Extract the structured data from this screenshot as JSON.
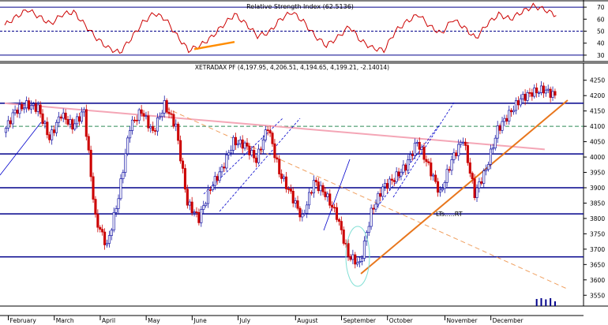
{
  "chart_data": [
    {
      "type": "line",
      "title": "Relative Strength Index (62.5136)",
      "y_ticks": [
        30,
        40,
        50,
        60,
        70
      ],
      "ylim": [
        26,
        74
      ],
      "reference_lines": [
        70,
        50,
        30
      ],
      "x_weeks": [
        0,
        1,
        2,
        3,
        4,
        5,
        6,
        7,
        8,
        9,
        10,
        11,
        12,
        13,
        14,
        15,
        16,
        17,
        18,
        19,
        20,
        21,
        22,
        23,
        24,
        25,
        26,
        27,
        28,
        29,
        30,
        31,
        32,
        33,
        34,
        35,
        36,
        37,
        38,
        39,
        40,
        41,
        42,
        43,
        44,
        45,
        46,
        47,
        48
      ],
      "values": [
        55,
        62,
        68,
        62,
        56,
        64,
        66,
        55,
        44,
        36,
        32,
        44,
        57,
        65,
        60,
        46,
        34,
        38,
        45,
        55,
        64,
        56,
        46,
        49,
        60,
        66,
        58,
        46,
        38,
        45,
        54,
        42,
        36,
        34,
        50,
        58,
        64,
        54,
        48,
        60,
        53,
        44,
        56,
        64,
        60,
        66,
        71,
        68,
        63
      ],
      "colors": {
        "line": "#cc0000",
        "reference": "#00008b",
        "highlight": "#ff8c00"
      },
      "highlight_segment": {
        "from": [
          16.5,
          35
        ],
        "to": [
          20,
          41
        ]
      }
    },
    {
      "type": "candlestick",
      "title": "XETRADAX PF (4,197.95, 4,206.51, 4,194.65, 4,199.21, -2.14014)",
      "y_ticks": [
        3550,
        3600,
        3650,
        3700,
        3750,
        3800,
        3850,
        3900,
        3950,
        4000,
        4050,
        4100,
        4150,
        4200,
        4250
      ],
      "ylim": [
        3525,
        4275
      ],
      "x_labels": [
        "February",
        "March",
        "April",
        "May",
        "June",
        "July",
        "August",
        "September",
        "October",
        "November",
        "December"
      ],
      "x_label_weeks": [
        1,
        5,
        9,
        13,
        17,
        21,
        26,
        30,
        34,
        39,
        43
      ],
      "weekly_close": [
        4080,
        4150,
        4170,
        4160,
        4060,
        4140,
        4100,
        4150,
        3800,
        3710,
        3870,
        4100,
        4150,
        4080,
        4170,
        4100,
        3850,
        3800,
        3900,
        3960,
        4050,
        4040,
        3990,
        4100,
        3950,
        3880,
        3800,
        3920,
        3880,
        3810,
        3680,
        3650,
        3820,
        3900,
        3930,
        3970,
        4050,
        3970,
        3880,
        3990,
        4060,
        3880,
        3960,
        4090,
        4140,
        4190,
        4210,
        4220,
        4200
      ],
      "horizontal_levels": [
        {
          "value": 4175,
          "color": "#00008b",
          "style": "solid"
        },
        {
          "value": 4100,
          "color": "#2e8b57",
          "style": "dashed"
        },
        {
          "value": 4010,
          "color": "#00008b",
          "style": "solid"
        },
        {
          "value": 3900,
          "color": "#00008b",
          "style": "solid"
        },
        {
          "value": 3815,
          "color": "#00008b",
          "style": "solid"
        },
        {
          "value": 3675,
          "color": "#00008b",
          "style": "solid"
        }
      ],
      "trendlines": [
        {
          "name": "pink resistance",
          "from": [
            0,
            4175
          ],
          "to": [
            47,
            4025
          ],
          "color": "#f4a6b6",
          "style": "solid"
        },
        {
          "name": "orange falling",
          "from": [
            14,
            4160
          ],
          "to": [
            49,
            3570
          ],
          "color": "#f0a060",
          "style": "dashed"
        },
        {
          "name": "long-term support",
          "from": [
            31,
            3620
          ],
          "to": [
            49,
            4185
          ],
          "color": "#e8761c",
          "style": "solid"
        }
      ],
      "annotation": "LTs.....RT",
      "colors": {
        "up": "#1a1aa6",
        "down": "#cc0000",
        "ellipse": "#7fdfd4",
        "channel": "#0000cc"
      },
      "volume_bars": {
        "weeks": [
          46.3,
          46.7,
          47.1,
          47.5,
          47.9
        ],
        "values": [
          0.9,
          1.0,
          0.85,
          1.0,
          0.6
        ]
      }
    }
  ]
}
